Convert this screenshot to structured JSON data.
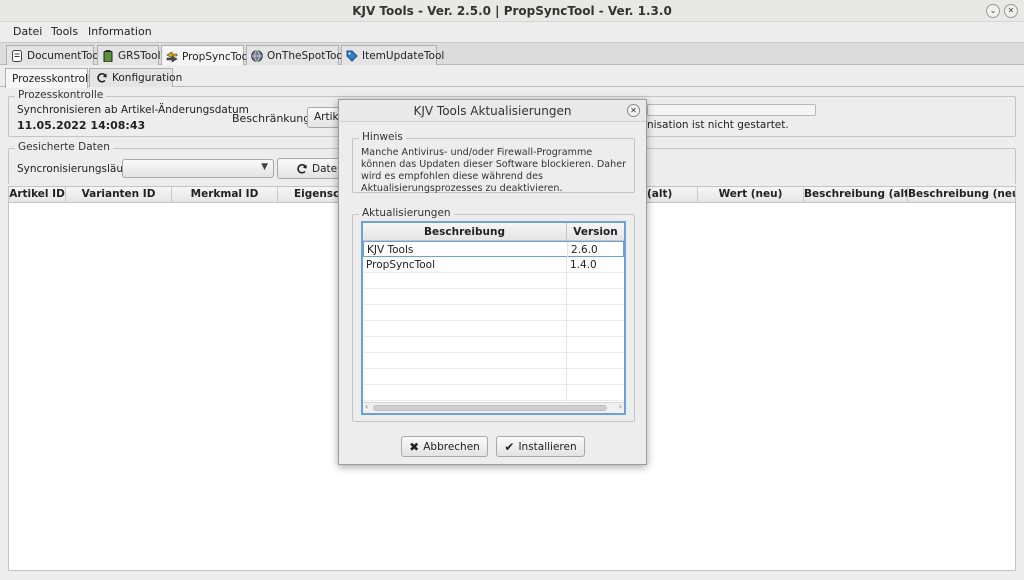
{
  "window": {
    "title": "KJV Tools - Ver. 2.5.0 | PropSyncTool - Ver. 1.3.0"
  },
  "menu": [
    "Datei",
    "Tools",
    "Information"
  ],
  "tabs": [
    {
      "label": "DocumentTool",
      "icon": "document-icon"
    },
    {
      "label": "GRSTool",
      "icon": "battery-icon"
    },
    {
      "label": "PropSyncTool",
      "icon": "sync-arrows-icon"
    },
    {
      "label": "OnTheSpotTool",
      "icon": "globe-icon"
    },
    {
      "label": "ItemUpdateTool",
      "icon": "tag-icon"
    }
  ],
  "subtabs": [
    {
      "label": "Prozesskontrolle"
    },
    {
      "label": "Konfiguration",
      "icon": "refresh-icon"
    }
  ],
  "prozess": {
    "legend": "Prozesskontrolle",
    "sync_label": "Synchronisieren ab Artikel-Änderungsdatum",
    "sync_datetime": "11.05.2022 14:08:43",
    "restriction_label": "Beschränkung",
    "restriction_value": "Artike",
    "status_text": "nisation ist nicht gestartet."
  },
  "saved": {
    "legend": "Gesicherte Daten",
    "runs_label": "Syncronisierungsläufe:",
    "data_button": "Daten"
  },
  "grid_columns": [
    "Artikel ID",
    "Varianten ID",
    "Merkmal ID",
    "Eigenscha",
    "(alt)",
    "Wert (neu)",
    "Beschreibung (alt)",
    "Beschreibung (neu)"
  ],
  "dialog": {
    "title": "KJV Tools Aktualisierungen",
    "notice_legend": "Hinweis",
    "notice_text": "Manche Antivirus- und/oder Firewall-Programme können das Updaten dieser Software blockieren. Daher wird es empfohlen diese während des Aktualisierungsprozesses zu deaktivieren.",
    "updates_legend": "Aktualisierungen",
    "columns": [
      "Beschreibung",
      "Version"
    ],
    "rows": [
      {
        "desc": "KJV Tools",
        "version": "2.6.0"
      },
      {
        "desc": "PropSyncTool",
        "version": "1.4.0"
      }
    ],
    "cancel_label": "Abbrechen",
    "install_label": "Installieren"
  },
  "colors": {
    "selection_border": "#6ba2d6",
    "background": "#ededed"
  }
}
